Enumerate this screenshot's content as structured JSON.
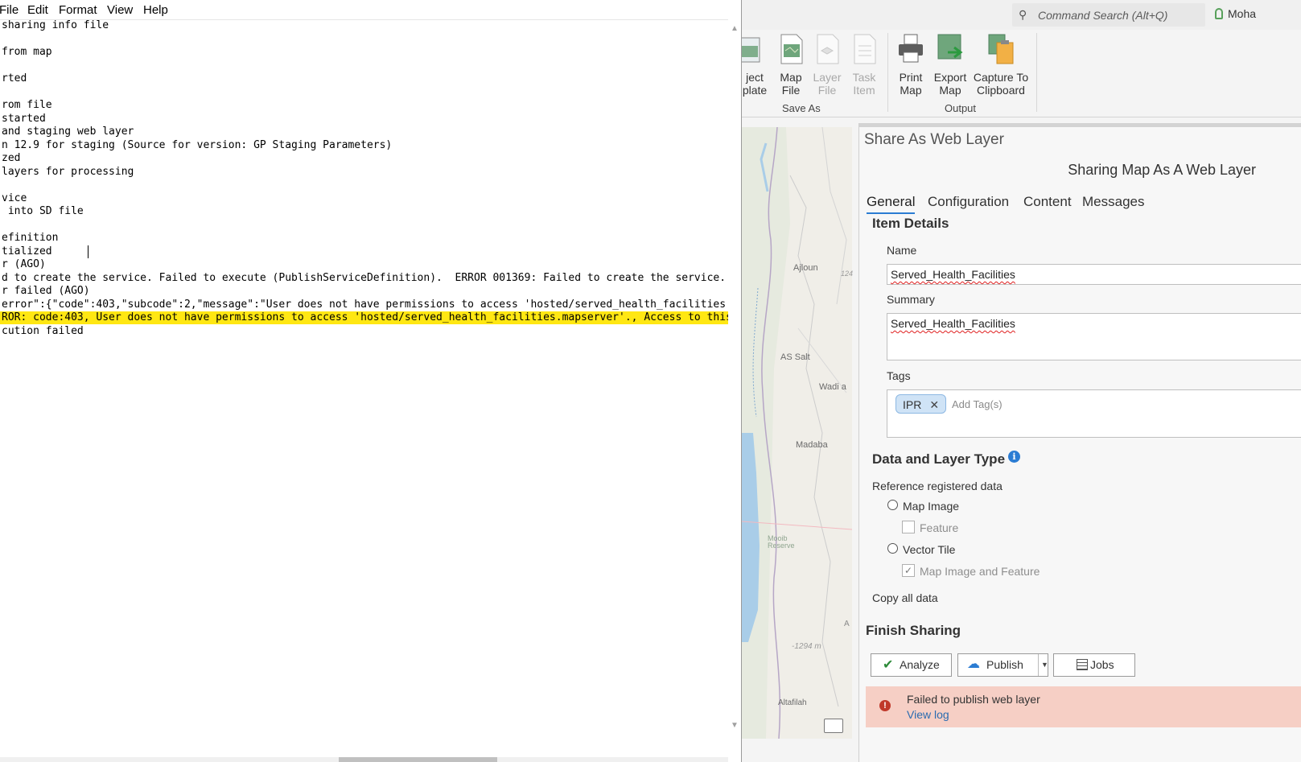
{
  "notepad": {
    "menu": [
      "File",
      "Edit",
      "Format",
      "View",
      "Help"
    ],
    "lines": [
      {
        "text": "sharing info file",
        "highlight": false
      },
      {
        "text": "",
        "highlight": false
      },
      {
        "text": "from map",
        "highlight": false
      },
      {
        "text": "",
        "highlight": false
      },
      {
        "text": "rted",
        "highlight": false
      },
      {
        "text": "",
        "highlight": false
      },
      {
        "text": "rom file",
        "highlight": false
      },
      {
        "text": "started",
        "highlight": false
      },
      {
        "text": "and staging web layer",
        "highlight": false
      },
      {
        "text": "n 12.9 for staging (Source for version: GP Staging Parameters)",
        "highlight": false
      },
      {
        "text": "zed",
        "highlight": false
      },
      {
        "text": "layers for processing",
        "highlight": false
      },
      {
        "text": "",
        "highlight": false
      },
      {
        "text": "vice",
        "highlight": false
      },
      {
        "text": " into SD file",
        "highlight": false
      },
      {
        "text": "",
        "highlight": false
      },
      {
        "text": "efinition",
        "highlight": false
      },
      {
        "text": "tialized",
        "highlight": false
      },
      {
        "text": "r (AGO)",
        "highlight": false
      },
      {
        "text": "d to create the service. Failed to execute (PublishServiceDefinition).  ERROR 001369: Failed to create the service.",
        "highlight": false
      },
      {
        "text": "r failed (AGO)",
        "highlight": false
      },
      {
        "text": "error\":{\"code\":403,\"subcode\":2,\"message\":\"User does not have permissions to access 'hosted/served_health_facilities.",
        "highlight": false
      },
      {
        "text": "ROR: code:403, User does not have permissions to access 'hosted/served_health_facilities.mapserver'., Access to this",
        "highlight": true
      },
      {
        "text": "cution failed",
        "highlight": false
      }
    ]
  },
  "arcgis": {
    "command_search_placeholder": "Command Search (Alt+Q)",
    "user_name": "Moha",
    "ribbon": {
      "save_as": {
        "label": "Save As",
        "buttons": [
          {
            "line1": "ject",
            "line2": "plate",
            "disabled": false
          },
          {
            "line1": "Map",
            "line2": "File",
            "disabled": false
          },
          {
            "line1": "Layer",
            "line2": "File",
            "disabled": true
          },
          {
            "line1": "Task",
            "line2": "Item",
            "disabled": true
          }
        ]
      },
      "output": {
        "label": "Output",
        "buttons": [
          {
            "line1": "Print",
            "line2": "Map",
            "disabled": false
          },
          {
            "line1": "Export",
            "line2": "Map",
            "disabled": false
          },
          {
            "line1": "Capture To",
            "line2": "Clipboard",
            "disabled": false
          }
        ]
      }
    },
    "map_labels": [
      "Ajloun",
      "AS Salt",
      "Wadi a",
      "Madaba",
      "Mooib Reserve",
      "-1294 m",
      "Altafilah",
      "124",
      "A"
    ],
    "share_pane": {
      "title": "Share As Web Layer",
      "subtitle": "Sharing Map As A Web Layer",
      "tabs": [
        "General",
        "Configuration",
        "Content",
        "Messages"
      ],
      "active_tab": "General",
      "item_details_heading": "Item Details",
      "name_label": "Name",
      "name_value": "Served_Health_Facilities",
      "summary_label": "Summary",
      "summary_value": "Served_Health_Facilities",
      "tags_label": "Tags",
      "tags": [
        "IPR"
      ],
      "add_tags_placeholder": "Add Tag(s)",
      "data_layer_heading": "Data and Layer Type",
      "reference_label": "Reference registered data",
      "map_image_label": "Map Image",
      "feature_label": "Feature",
      "vector_tile_label": "Vector Tile",
      "map_image_feature_label": "Map Image and Feature",
      "copy_all_label": "Copy all data",
      "finish_heading": "Finish Sharing",
      "analyze_label": "Analyze",
      "publish_label": "Publish",
      "jobs_label": "Jobs",
      "error_message": "Failed to publish web layer",
      "view_log_label": "View log"
    },
    "colors": {
      "accent": "#2b7cd3",
      "error_bg": "#f6cfc5",
      "highlight": "#ffe713"
    }
  }
}
